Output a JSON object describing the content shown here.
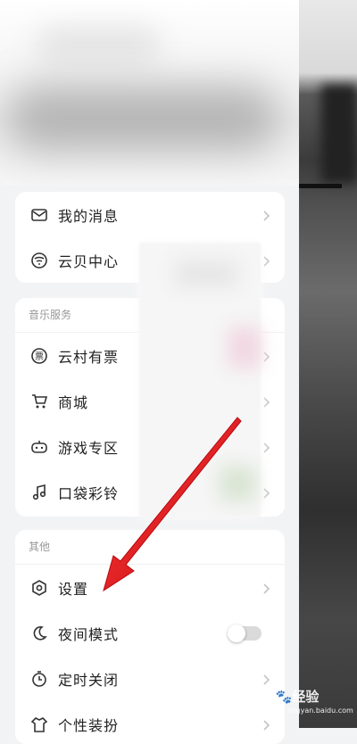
{
  "top_card": {
    "items": [
      {
        "label": "我的消息",
        "icon": "mail-icon"
      },
      {
        "label": "云贝中心",
        "icon": "coin-icon"
      }
    ]
  },
  "music_section": {
    "title": "音乐服务",
    "items": [
      {
        "label": "云村有票",
        "icon": "ticket-icon"
      },
      {
        "label": "商城",
        "icon": "cart-icon"
      },
      {
        "label": "游戏专区",
        "icon": "gamepad-icon"
      },
      {
        "label": "口袋彩铃",
        "icon": "music-note-icon"
      }
    ]
  },
  "other_section": {
    "title": "其他",
    "items": [
      {
        "label": "设置",
        "icon": "settings-icon"
      },
      {
        "label": "夜间模式",
        "icon": "moon-icon",
        "toggle": false
      },
      {
        "label": "定时关闭",
        "icon": "timer-icon"
      },
      {
        "label": "个性装扮",
        "icon": "shirt-icon"
      }
    ]
  },
  "watermark": {
    "brand": "Bai",
    "suffix": "经验",
    "url": "jingyan.baidu.com"
  },
  "colors": {
    "arrow": "#e8141b",
    "background": "#f2f3f5",
    "card": "#ffffff"
  }
}
